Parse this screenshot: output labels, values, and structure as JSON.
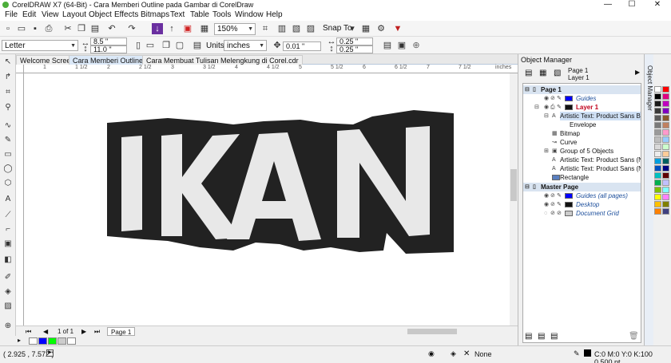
{
  "window": {
    "title": "CorelDRAW X7 (64-Bit) - Cara Memberi Outline pada Gambar di CorelDraw",
    "minimize": "—",
    "maximize": "☐",
    "close": "✕"
  },
  "menu": [
    "File",
    "Edit",
    "View",
    "Layout",
    "Object",
    "Effects",
    "Bitmaps",
    "Text",
    "Table",
    "Tools",
    "Window",
    "Help"
  ],
  "toolbar": {
    "zoom_value": "150%",
    "snap_to_label": "Snap To"
  },
  "propertybar": {
    "page_size": "Letter",
    "width": "8.5 \"",
    "height": "11.0 \"",
    "units_label": "Units:",
    "units_value": "inches",
    "nudge": "0.01 \"",
    "dup_x": "0.25 \"",
    "dup_y": "0.25 \""
  },
  "tabs": [
    {
      "label": "Welcome Screen",
      "active": false
    },
    {
      "label": "Cara Memberi Outline ...",
      "active": true
    },
    {
      "label": "Cara Membuat Tulisan Melengkung di Corel.cdr",
      "active": false
    }
  ],
  "ruler": {
    "units": "inches",
    "ticks": [
      "1",
      "1 1/2",
      "2",
      "2 1/2",
      "3",
      "3 1/2",
      "4",
      "4 1/2",
      "5",
      "5 1/2",
      "6",
      "6 1/2",
      "7",
      "7 1/2"
    ]
  },
  "canvas": {
    "artwork_text": "IKAN",
    "fill_color": "#e8e8e8",
    "outline_color": "#222222"
  },
  "pagenav": {
    "page_count": "1 of 1",
    "page_tab": "Page 1"
  },
  "status": {
    "coords": "( 2.925 , 7.572 )",
    "fill_none": "None",
    "color_readout": "C:0 M:0 Y:0 K:100  0.500 pt"
  },
  "object_manager": {
    "title": "Object Manager",
    "page_label": "Page 1",
    "layer_label": "Layer 1",
    "docker_tab_label": "Object Manager",
    "rows": [
      {
        "text": "Page 1",
        "type": "header"
      },
      {
        "text": "Guides",
        "type": "guides"
      },
      {
        "text": "Layer 1",
        "type": "layer"
      },
      {
        "text": "Artistic Text: Product Sans Bla",
        "type": "selected"
      },
      {
        "text": "Envelope",
        "type": "child"
      },
      {
        "text": "Bitmap",
        "type": "item"
      },
      {
        "text": "Curve",
        "type": "item"
      },
      {
        "text": "Group of 5 Objects",
        "type": "group"
      },
      {
        "text": "Artistic Text: Product Sans (No",
        "type": "item"
      },
      {
        "text": "Artistic Text: Product Sans (No",
        "type": "item"
      },
      {
        "text": "Rectangle",
        "type": "item"
      },
      {
        "text": "Master Page",
        "type": "header"
      },
      {
        "text": "Guides (all pages)",
        "type": "master"
      },
      {
        "text": "Desktop",
        "type": "master"
      },
      {
        "text": "Document Grid",
        "type": "master"
      }
    ]
  },
  "colors": {
    "accent": "#1e62b4",
    "palette": [
      "#ffffff",
      "#000000",
      "#1b1b1b",
      "#3a3a3a",
      "#5a5a5a",
      "#7a7a7a",
      "#9a9a9a",
      "#bdbdbd",
      "#d9d9d9",
      "#ececec",
      "#00a0e0",
      "#0050c0",
      "#00c0c0",
      "#00b050",
      "#80c000",
      "#ffff00",
      "#ffc000",
      "#ff8000",
      "#ff0000",
      "#e00080",
      "#c000c0",
      "#8000c0",
      "#8b5a2b",
      "#c08060",
      "#ff99cc",
      "#99ccff",
      "#ccffcc",
      "#ffcc99",
      "#006060",
      "#000080",
      "#600000",
      "#c0c0ff",
      "#80ffff",
      "#ff80ff",
      "#808000",
      "#404080"
    ],
    "bottom_swatches": [
      "#ffffff",
      "#0000ff",
      "#00ff00",
      "#cccccc",
      "#ffffff"
    ]
  }
}
